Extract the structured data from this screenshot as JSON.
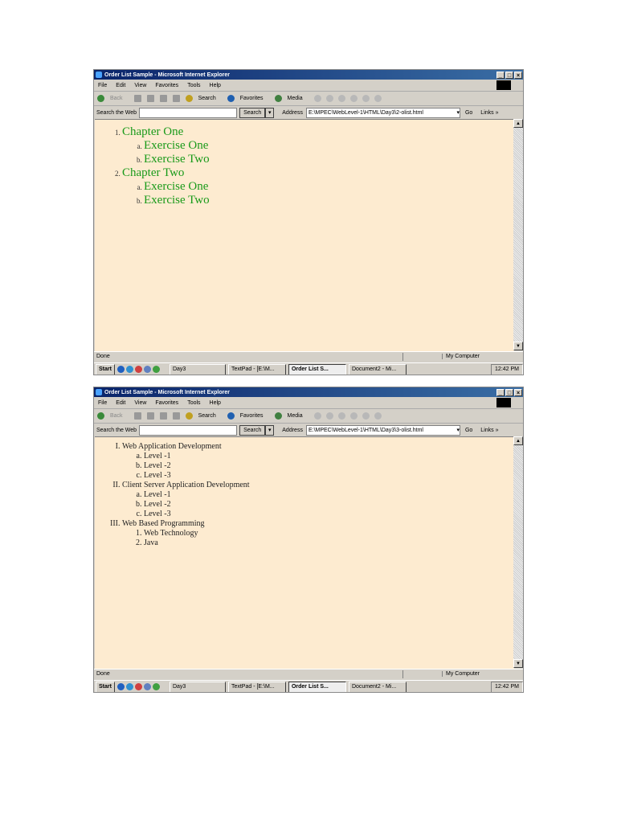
{
  "windows": [
    {
      "title": "Order List Sample - Microsoft Internet Explorer",
      "menu": [
        "File",
        "Edit",
        "View",
        "Favorites",
        "Tools",
        "Help"
      ],
      "toolbar": [
        "Back",
        "Search",
        "Favorites",
        "Media"
      ],
      "search_label": "Search the Web",
      "search_button": "Search",
      "address_label": "Address",
      "address": "E:\\MPEC\\WebLevel-1\\HTML\\Day3\\2-olist.html",
      "go": "Go",
      "links": "Links »",
      "status": "Done",
      "zone": "My Computer",
      "taskbar": {
        "start": "Start",
        "items": [
          "Day3",
          "TextPad - [E:\\M...",
          "Order List S...",
          "Document2 - Mi..."
        ],
        "clock": "12:42 PM"
      },
      "list": [
        {
          "label": "Chapter One",
          "children": [
            "Exercise One",
            "Exercise Two"
          ]
        },
        {
          "label": "Chapter Two",
          "children": [
            "Exercise One",
            "Exercise Two"
          ]
        }
      ]
    },
    {
      "title": "Order List Sample - Microsoft Internet Explorer",
      "menu": [
        "File",
        "Edit",
        "View",
        "Favorites",
        "Tools",
        "Help"
      ],
      "toolbar": [
        "Back",
        "Search",
        "Favorites",
        "Media"
      ],
      "search_label": "Search the Web",
      "search_button": "Search",
      "address_label": "Address",
      "address": "E:\\MPEC\\WebLevel-1\\HTML\\Day3\\3-olist.html",
      "go": "Go",
      "links": "Links »",
      "status": "Done",
      "zone": "My Computer",
      "taskbar": {
        "start": "Start",
        "items": [
          "Day3",
          "TextPad - [E:\\M...",
          "Order List S...",
          "Document2 - Mi..."
        ],
        "clock": "12:42 PM"
      },
      "list": [
        {
          "label": "Web Application Development",
          "children": [
            "Level -1",
            "Level -2",
            "Level -3"
          ]
        },
        {
          "label": "Client Server Application Development",
          "children": [
            "Level -1",
            "Level -2",
            "Level -3"
          ]
        },
        {
          "label": "Web Based Programming",
          "children": [
            "Web Technology",
            "Java"
          ],
          "numbered": true
        }
      ]
    }
  ]
}
